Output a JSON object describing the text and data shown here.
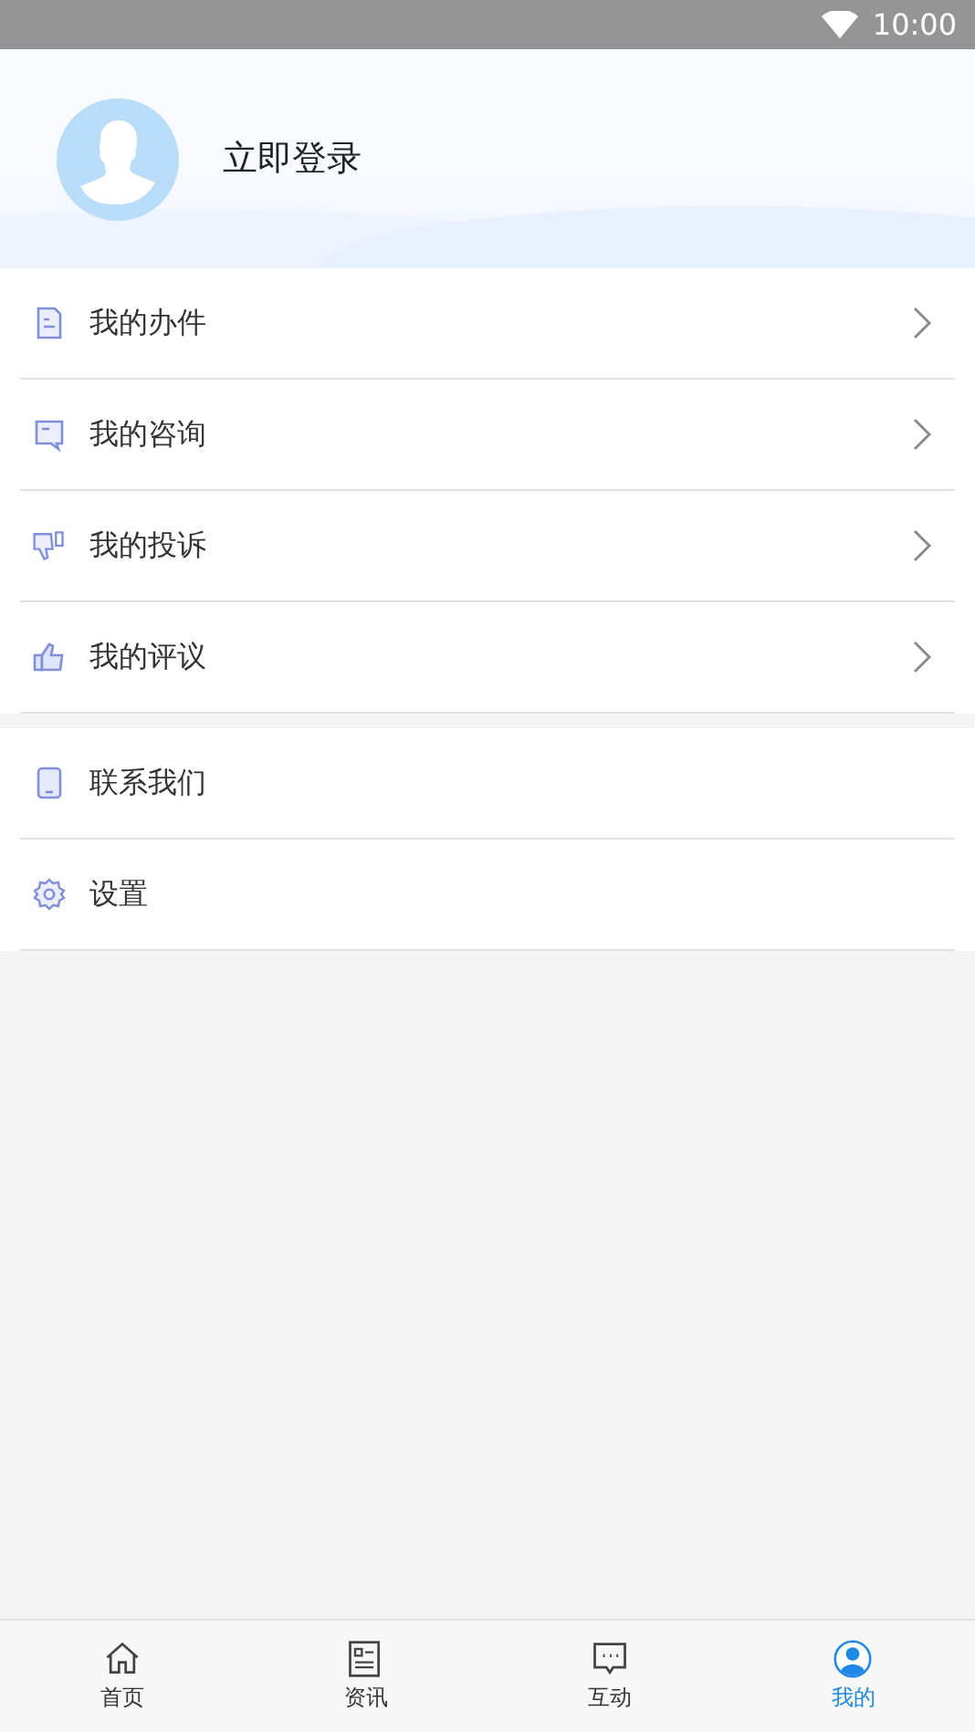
{
  "status_bar": {
    "time": "10:00"
  },
  "profile": {
    "login_label": "立即登录"
  },
  "menu_groups": [
    {
      "items": [
        {
          "label": "我的办件",
          "kind": "document",
          "chevron": true
        },
        {
          "label": "我的咨询",
          "kind": "chat",
          "chevron": true
        },
        {
          "label": "我的投诉",
          "kind": "dislike",
          "chevron": true
        },
        {
          "label": "我的评议",
          "kind": "like",
          "chevron": true
        }
      ]
    },
    {
      "items": [
        {
          "label": "联系我们",
          "kind": "phone",
          "chevron": false
        },
        {
          "label": "设置",
          "kind": "gear",
          "chevron": false
        }
      ]
    }
  ],
  "tab_bar": [
    {
      "label": "首页",
      "kind": "home",
      "selected": false
    },
    {
      "label": "资讯",
      "kind": "news",
      "selected": false
    },
    {
      "label": "互动",
      "kind": "chat",
      "selected": false
    },
    {
      "label": "我的",
      "kind": "person",
      "selected": true
    }
  ]
}
